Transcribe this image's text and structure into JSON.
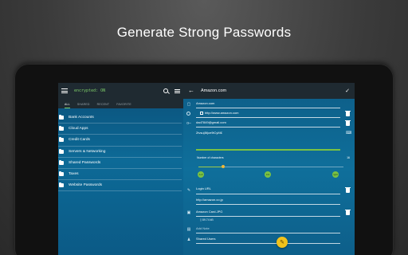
{
  "headline": "Generate Strong Passwords",
  "left_pane": {
    "app_title": "encrypted: ON",
    "icons": [
      "hamburger-menu-icon",
      "search-icon",
      "list-icon"
    ],
    "tabs": [
      {
        "label": "ALL",
        "active": true
      },
      {
        "label": "SHARED",
        "active": false
      },
      {
        "label": "RECENT",
        "active": false
      },
      {
        "label": "FAVORITE",
        "active": false
      }
    ],
    "folders": [
      {
        "label": "Bank Accounts",
        "icon": "folder-icon"
      },
      {
        "label": "Cloud Apps",
        "icon": "folder-icon"
      },
      {
        "label": "Credit Cards",
        "icon": "folder-icon"
      },
      {
        "label": "Servers & Networking",
        "icon": "folder-icon"
      },
      {
        "label": "Shared Passwords",
        "icon": "folder-icon"
      },
      {
        "label": "Taxes",
        "icon": "folder-icon"
      },
      {
        "label": "Website Passwords",
        "icon": "folder-icon"
      }
    ]
  },
  "detail": {
    "title": "Amazon.com",
    "name_value": "Amazon.com",
    "url_value": "http://www.amazon.com",
    "email_value": "dad7849@gmail.com",
    "password_value": "2tvsu|8t|ce9tCyM£",
    "num_characters_label": "Number of characters",
    "num_characters_value": "16",
    "toggle_labels": [
      "A-Z",
      "0-9",
      "!@#"
    ],
    "login_url_label": "Login URL",
    "login_url_value": "http://amazon.co.jp",
    "attachment_name": "Amazon Card.JPG",
    "attachment_size": "89.74 kB",
    "add_note_placeholder": "Add Note",
    "shared_users_label": "Shared Users"
  },
  "colors": {
    "accent_green": "#7ac243",
    "fab_yellow": "#f1c21b",
    "topbar": "#1f2a31"
  }
}
